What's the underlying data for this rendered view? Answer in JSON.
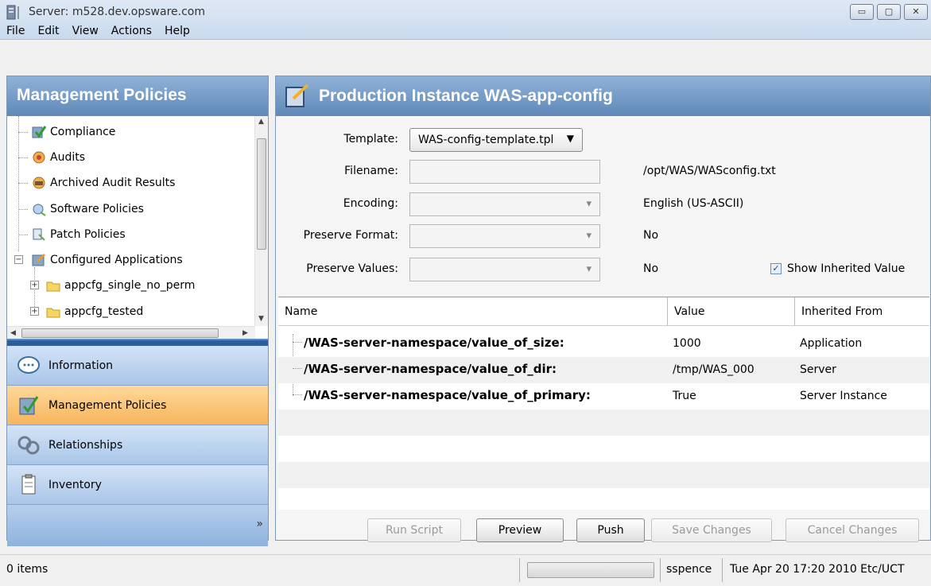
{
  "window": {
    "title": "Server: m528.dev.opsware.com",
    "buttons": [
      "minimize",
      "maximize",
      "close"
    ]
  },
  "menu": [
    "File",
    "Edit",
    "View",
    "Actions",
    "Help"
  ],
  "left_panel": {
    "title": "Management Policies",
    "tree": [
      {
        "label": "Compliance",
        "icon": "compliance-icon"
      },
      {
        "label": "Audits",
        "icon": "audits-icon"
      },
      {
        "label": "Archived Audit Results",
        "icon": "archived-audit-icon"
      },
      {
        "label": "Software Policies",
        "icon": "software-policy-icon"
      },
      {
        "label": "Patch Policies",
        "icon": "patch-policy-icon"
      },
      {
        "label": "Configured Applications",
        "icon": "configured-apps-icon",
        "expanded": true
      },
      {
        "label": "appcfg_single_no_perm",
        "icon": "folder-icon"
      },
      {
        "label": "appcfg_tested",
        "icon": "folder-icon"
      }
    ],
    "nav": [
      {
        "label": "Information",
        "icon": "information-icon",
        "active": false
      },
      {
        "label": "Management Policies",
        "icon": "management-policies-icon",
        "active": true
      },
      {
        "label": "Relationships",
        "icon": "relationships-icon",
        "active": false
      },
      {
        "label": "Inventory",
        "icon": "inventory-icon",
        "active": false
      }
    ],
    "more_label": "»"
  },
  "right_panel": {
    "title": "Production Instance WAS-app-config",
    "form": {
      "template_label": "Template:",
      "template_value": "WAS-config-template.tpl",
      "filename_label": "Filename:",
      "filename_value": "/opt/WAS/WASconfig.txt",
      "encoding_label": "Encoding:",
      "encoding_value": "English (US-ASCII)",
      "preserve_format_label": "Preserve Format:",
      "preserve_format_value": "No",
      "preserve_values_label": "Preserve Values:",
      "preserve_values_value": "No",
      "show_inherited_label": "Show Inherited Value",
      "show_inherited_checked": true
    },
    "table": {
      "columns": [
        "Name",
        "Value",
        "Inherited From"
      ],
      "rows": [
        {
          "name": "/WAS-server-namespace/value_of_size:",
          "value": "1000",
          "inherited": "Application"
        },
        {
          "name": "/WAS-server-namespace/value_of_dir:",
          "value": "/tmp/WAS_000",
          "inherited": "Server"
        },
        {
          "name": "/WAS-server-namespace/value_of_primary:",
          "value": "True",
          "inherited": "Server Instance"
        }
      ]
    },
    "buttons": {
      "run_script": "Run Script",
      "preview": "Preview",
      "push": "Push",
      "save_changes": "Save Changes",
      "cancel_changes": "Cancel Changes"
    }
  },
  "status": {
    "items": "0 items",
    "user": "sspence",
    "timestamp": "Tue Apr 20 17:20 2010 Etc/UCT"
  }
}
